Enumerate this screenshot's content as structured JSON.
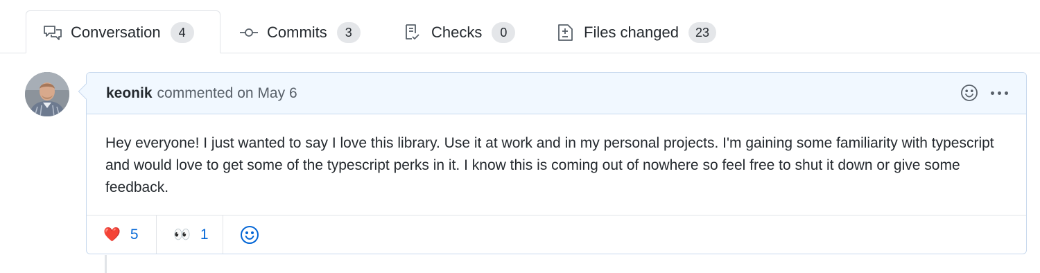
{
  "tabs": [
    {
      "label": "Conversation",
      "count": "4",
      "icon": "comment-discussion-icon",
      "active": true
    },
    {
      "label": "Commits",
      "count": "3",
      "icon": "git-commit-icon",
      "active": false
    },
    {
      "label": "Checks",
      "count": "0",
      "icon": "checklist-icon",
      "active": false
    },
    {
      "label": "Files changed",
      "count": "23",
      "icon": "file-diff-icon",
      "active": false
    }
  ],
  "comment": {
    "author": "keonik",
    "action": "commented",
    "date": "on May 6",
    "body": "Hey everyone! I just wanted to say I love this library. Use it at work and in my personal projects. I'm gaining some familiarity with typescript and would love to get some of the typescript perks in it. I know this is coming out of nowhere so feel free to shut it down or give some feedback.",
    "reactions": [
      {
        "emoji": "❤️",
        "icon": "heart-emoji",
        "count": "5"
      },
      {
        "emoji": "👀",
        "icon": "eyes-emoji",
        "count": "1"
      }
    ]
  },
  "colors": {
    "link": "#0366d6",
    "header_bg": "#f1f8ff",
    "border_blue": "#c8d9ee",
    "counter_bg": "#e4e6e9"
  }
}
